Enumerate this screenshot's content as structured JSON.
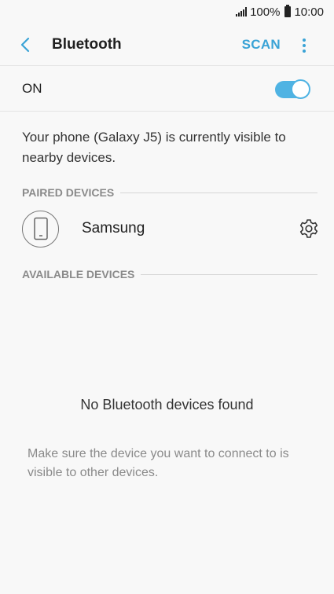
{
  "status_bar": {
    "battery": "100%",
    "time": "10:00"
  },
  "app_bar": {
    "title": "Bluetooth",
    "scan_label": "SCAN"
  },
  "toggle_row": {
    "label": "ON",
    "state": true
  },
  "visibility_message": "Your phone (Galaxy J5) is currently visible to nearby devices.",
  "paired_section": {
    "header": "PAIRED DEVICES",
    "devices": [
      {
        "name": "Samsung",
        "icon": "phone-icon"
      }
    ]
  },
  "available_section": {
    "header": "AVAILABLE DEVICES",
    "empty_title": "No Bluetooth devices found",
    "empty_hint": "Make sure the device you want to connect to is visible to other devices."
  },
  "colors": {
    "accent": "#3aa3d6",
    "toggle_on": "#4fb3e3",
    "background": "#f8f8f8"
  }
}
